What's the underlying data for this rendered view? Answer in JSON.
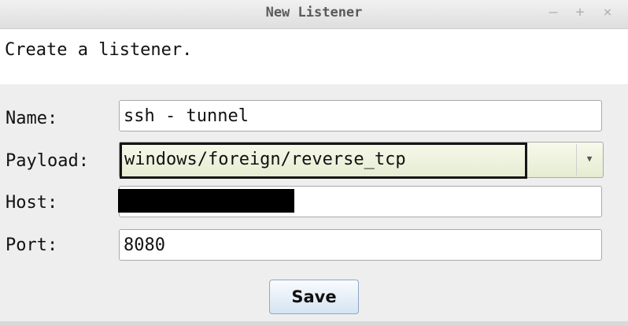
{
  "window": {
    "title": "New Listener",
    "controls": [
      "–",
      "+",
      "×"
    ]
  },
  "intro": "Create a listener.",
  "form": {
    "name_label": "Name:",
    "name_value": "ssh - tunnel",
    "payload_label": "Payload:",
    "payload_value": "windows/foreign/reverse_tcp",
    "host_label": "Host:",
    "port_label": "Port:",
    "port_value": "8080"
  },
  "save_label": "Save",
  "icons": {
    "dropdown": "chevron-down-icon",
    "minimize": "minimize-icon",
    "maximize": "maximize-icon",
    "close": "close-icon"
  },
  "colors": {
    "payload_field_bg": "#eef2dc",
    "save_button_bg": "#d6e4f3"
  }
}
